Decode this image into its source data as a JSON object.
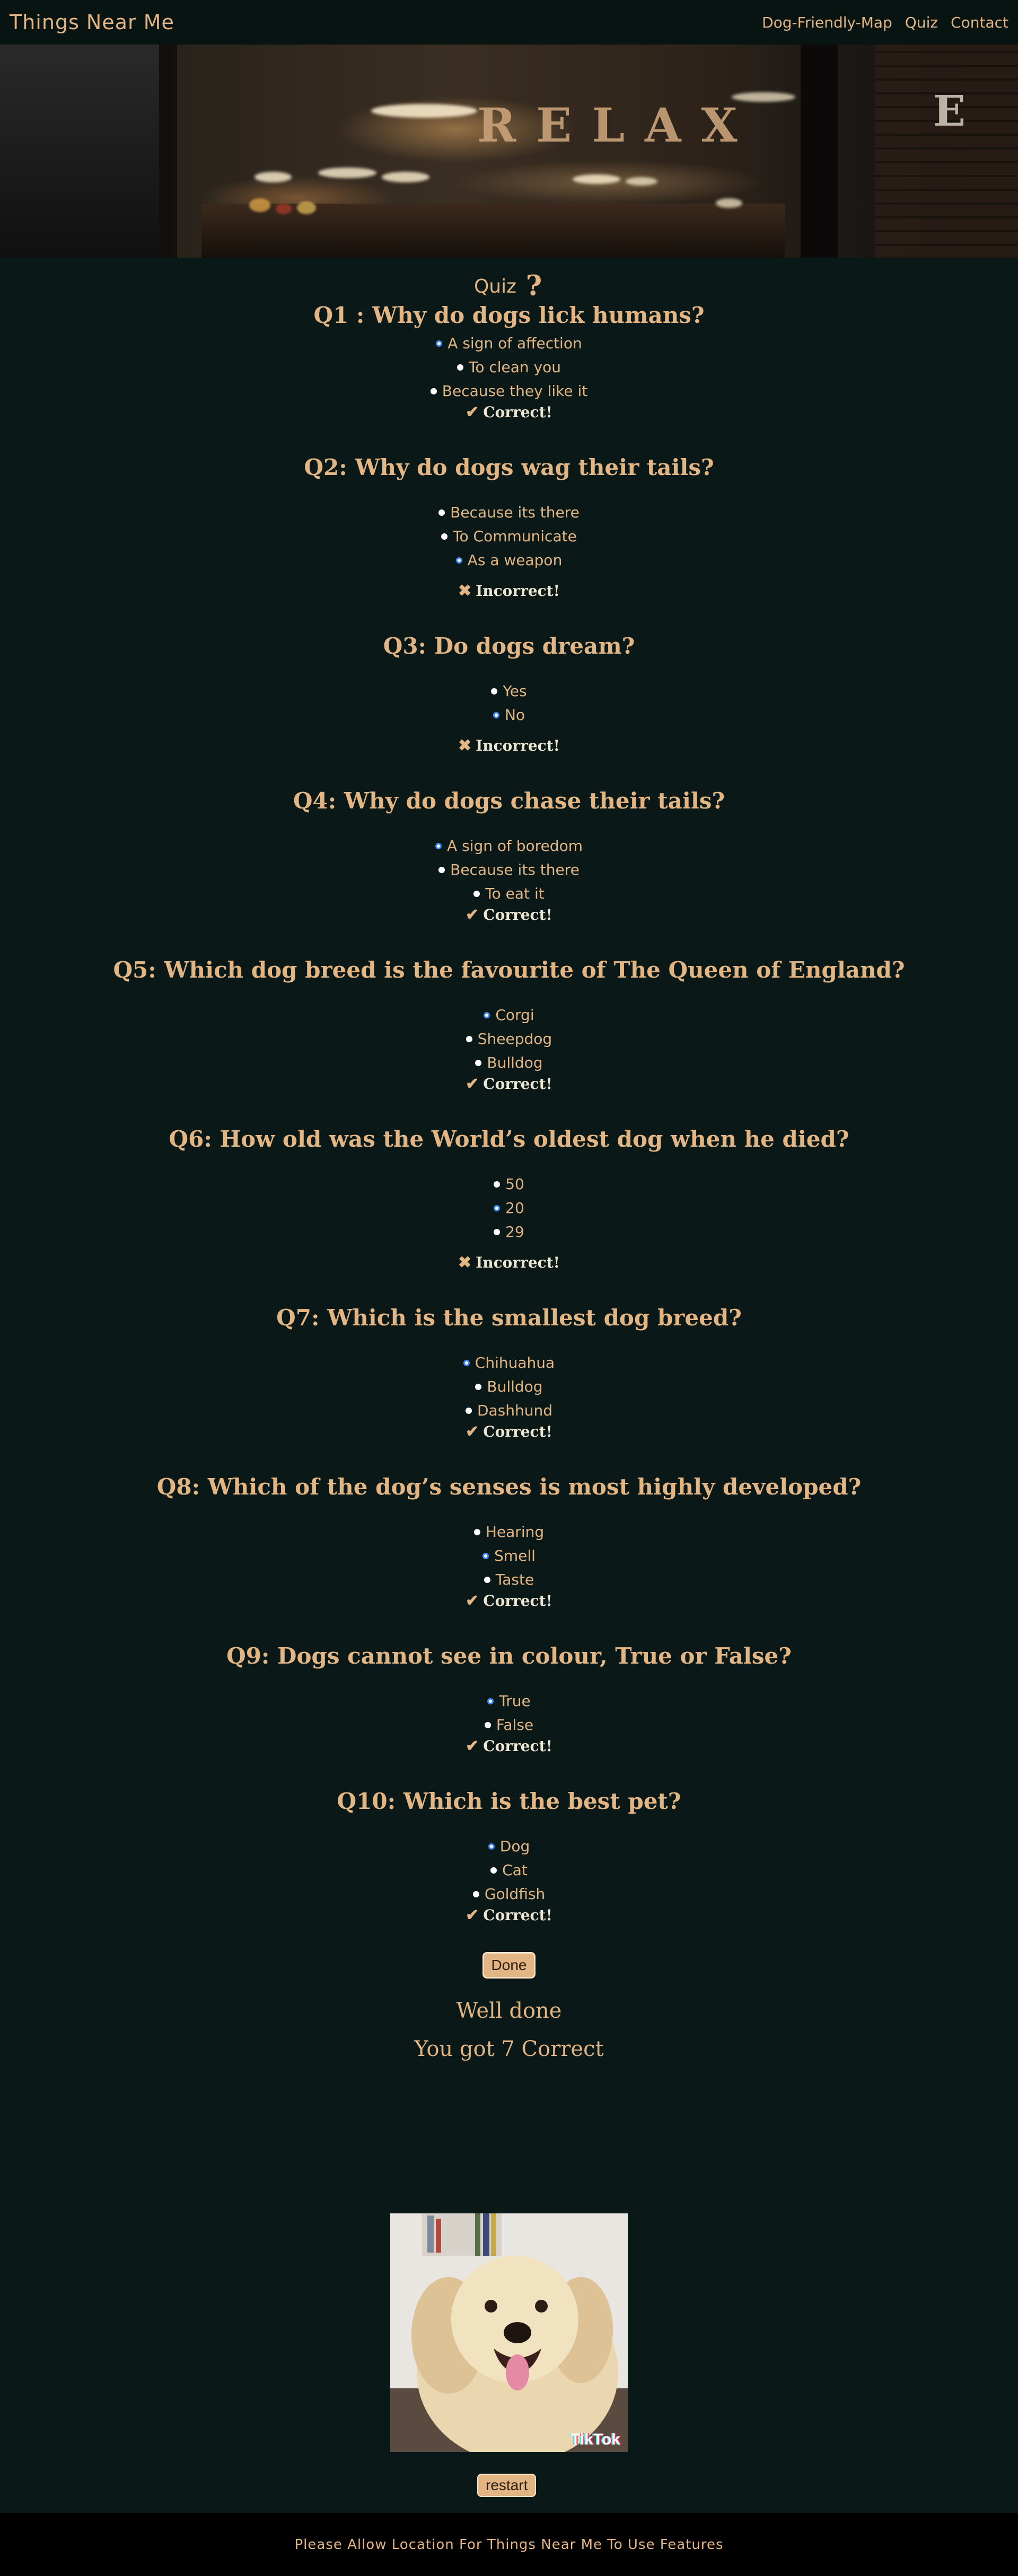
{
  "nav": {
    "brand": "Things Near Me",
    "links": [
      "Dog-Friendly-Map",
      "Quiz",
      "Contact"
    ]
  },
  "hero": {
    "sign_text": "RELAX",
    "sign_extra": "E"
  },
  "quiz": {
    "title": "Quiz",
    "questions": [
      {
        "question": "Q1 : Why do dogs lick humans?",
        "options": [
          "A sign of affection",
          "To clean you",
          "Because they like it"
        ],
        "selected": 0,
        "result": "Correct!",
        "correct": true
      },
      {
        "question": "Q2: Why do dogs wag their tails?",
        "options": [
          "Because its there",
          "To Communicate",
          "As a weapon"
        ],
        "selected": 2,
        "result": "Incorrect!",
        "correct": false
      },
      {
        "question": "Q3: Do dogs dream?",
        "options": [
          "Yes",
          "No"
        ],
        "selected": 1,
        "result": "Incorrect!",
        "correct": false
      },
      {
        "question": "Q4: Why do dogs chase their tails?",
        "options": [
          "A sign of boredom",
          "Because its there",
          "To eat it"
        ],
        "selected": 0,
        "result": "Correct!",
        "correct": true
      },
      {
        "question": "Q5: Which dog breed is the favourite of The Queen of England?",
        "options": [
          "Corgi",
          "Sheepdog",
          "Bulldog"
        ],
        "selected": 0,
        "result": "Correct!",
        "correct": true
      },
      {
        "question": "Q6: How old was the World’s oldest dog when he died?",
        "options": [
          "50",
          "20",
          "29"
        ],
        "selected": 1,
        "result": "Incorrect!",
        "correct": false
      },
      {
        "question": "Q7: Which is the smallest dog breed?",
        "options": [
          "Chihuahua",
          "Bulldog",
          "Dashhund"
        ],
        "selected": 0,
        "result": "Correct!",
        "correct": true
      },
      {
        "question": "Q8: Which of the dog’s senses is most highly developed?",
        "options": [
          "Hearing",
          "Smell",
          "Taste"
        ],
        "selected": 1,
        "result": "Correct!",
        "correct": true
      },
      {
        "question": "Q9: Dogs cannot see in colour, True or False?",
        "options": [
          "True",
          "False"
        ],
        "selected": 0,
        "result": "Correct!",
        "correct": true
      },
      {
        "question": "Q10: Which is the best pet?",
        "options": [
          "Dog",
          "Cat",
          "Goldfish"
        ],
        "selected": 0,
        "result": "Correct!",
        "correct": true
      }
    ],
    "done_label": "Done",
    "well_done": "Well done",
    "score_text": "You got 7 Correct",
    "restart_label": "restart",
    "image_watermark": "TikTok"
  },
  "footer": {
    "message": "Please Allow Location For Things Near Me To Use Features"
  },
  "colors": {
    "background": "#0a1917",
    "accent": "#e2b583",
    "radio_selected": "#3d8bff"
  },
  "icons": {
    "correct": "check-icon",
    "incorrect": "cross-icon",
    "quiz": "question-mark-icon"
  }
}
